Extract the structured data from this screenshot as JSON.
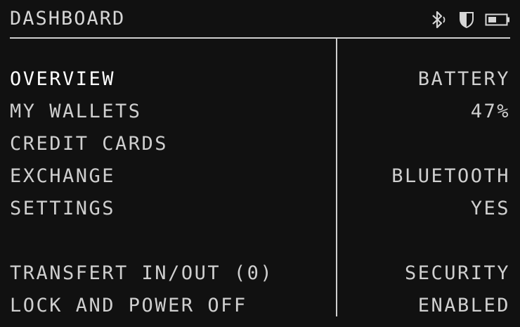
{
  "header": {
    "title": "DASHBOARD",
    "icons": [
      "bluetooth-icon",
      "shield-icon",
      "battery-icon"
    ]
  },
  "menu": {
    "items": [
      {
        "label": "OVERVIEW",
        "active": true
      },
      {
        "label": "MY WALLETS",
        "active": false
      },
      {
        "label": "CREDIT CARDS",
        "active": false
      },
      {
        "label": "EXCHANGE",
        "active": false
      },
      {
        "label": "SETTINGS",
        "active": false
      }
    ],
    "secondary_items": [
      {
        "label": "TRANSFERT IN/OUT (0)"
      },
      {
        "label": "LOCK AND POWER OFF"
      }
    ]
  },
  "status": {
    "battery_label": "BATTERY",
    "battery_value": "47%",
    "bluetooth_label": "BLUETOOTH",
    "bluetooth_value": "YES",
    "security_label": "SECURITY",
    "security_value": "ENABLED"
  },
  "colors": {
    "background": "#111111",
    "text": "#cfcfcf",
    "active_text": "#ffffff"
  }
}
